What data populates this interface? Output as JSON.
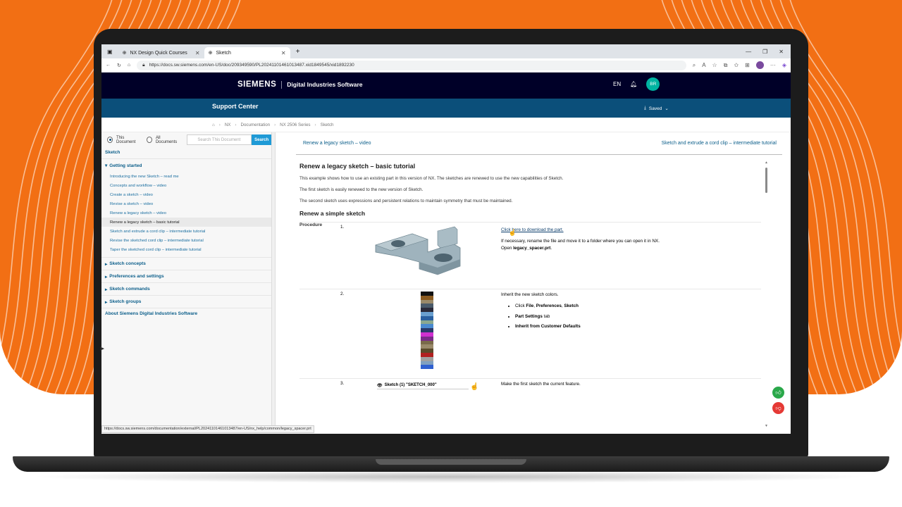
{
  "browser": {
    "tabs": [
      {
        "title": "NX Design Quick Courses",
        "active": false
      },
      {
        "title": "Sketch",
        "active": true
      }
    ],
    "new_tab": "+",
    "url": "https://docs.sw.siemens.com/en-US/doc/209349590/PL20241101461013487.xid1849545/xid1892230",
    "status_url": "https://docs.sw.siemens.com/documentation/external/PL20241101461013487/en-US/nx_help/common/legacy_spacer.prt"
  },
  "site": {
    "brand": "SIEMENS",
    "subtitle": "Digital Industries Software",
    "lang": "EN",
    "user_initials": "BR",
    "support_title": "Support Center",
    "saved_label": "Saved"
  },
  "breadcrumb": [
    "NX",
    "Documentation",
    "NX 2506 Series",
    "Sketch"
  ],
  "search": {
    "this_document": "This Document",
    "all_documents": "All Documents",
    "placeholder": "Search This Document",
    "button": "Search"
  },
  "nav": {
    "root": "Sketch",
    "getting_started": "Getting started",
    "getting_started_items": [
      "Introducing the new Sketch – read me",
      "Concepts and workflow – video",
      "Create a sketch – video",
      "Revise a sketch – video",
      "Renew a legacy sketch – video",
      "Renew a legacy sketch – basic tutorial",
      "Sketch and extrude a cord clip – intermediate tutorial",
      "Revise the sketched cord clip – intermediate tutorial",
      "Taper the sketched cord clip – intermediate tutorial"
    ],
    "groups": [
      "Sketch concepts",
      "Preferences and settings",
      "Sketch commands",
      "Sketch groups"
    ],
    "about": "About Siemens Digital Industries Software"
  },
  "article": {
    "prev_link": "Renew a legacy sketch – video",
    "next_link": "Sketch and extrude a cord clip – intermediate tutorial",
    "title": "Renew a legacy sketch – basic tutorial",
    "p1": "This example shows how to use an existing part in this version of NX. The sketches are renewed to use the new capabilities of Sketch.",
    "p2": "The first sketch is easily renewed to the new version of Sketch.",
    "p3": "The second sketch uses expressions and persistent relations to maintain symmetry that must be maintained.",
    "h2": "Renew a simple sketch",
    "procedure": "Procedure",
    "step1": {
      "num": "1.",
      "link": "Click here to download the part.",
      "line2": "If necessary, rename the file and move it to a folder where you can open it in NX.",
      "open_prefix": "Open ",
      "open_file": "legacy_spacer.prt",
      "open_suffix": "."
    },
    "step2": {
      "num": "2.",
      "line1": "Inherit the new sketch colors.",
      "b1_prefix": "Click ",
      "b1_file": "File",
      "b1_sep1": ", ",
      "b1_pref": "Preferences",
      "b1_sep2": ", ",
      "b1_sketch": "Sketch",
      "b2_label": "Part Settings",
      "b2_suffix": " tab",
      "b3_label": "Inherit from Customer Defaults"
    },
    "step3": {
      "num": "3.",
      "sketch_label": "Sketch (1) \"SKETCH_000\"",
      "line1": "Make the first sketch the current feature."
    }
  },
  "colors": {
    "header_bg": "#000028",
    "support_bg": "#0b4f7a",
    "link": "#0b5e8a",
    "accent": "#f26f14",
    "swatches": [
      "#111111",
      "#8a5a20",
      "#9a8a6a",
      "#4a5a6a",
      "#2a2a3a",
      "#6aa0d0",
      "#2a60a0",
      "#8aa890",
      "#4a8ad0",
      "#2a3a6a",
      "#d030d0",
      "#7a2a8a",
      "#7a6a4a",
      "#9a8a6a",
      "#5a4a2a",
      "#b02020",
      "#a0a0a0",
      "#80a0c0",
      "#3060d0"
    ]
  }
}
